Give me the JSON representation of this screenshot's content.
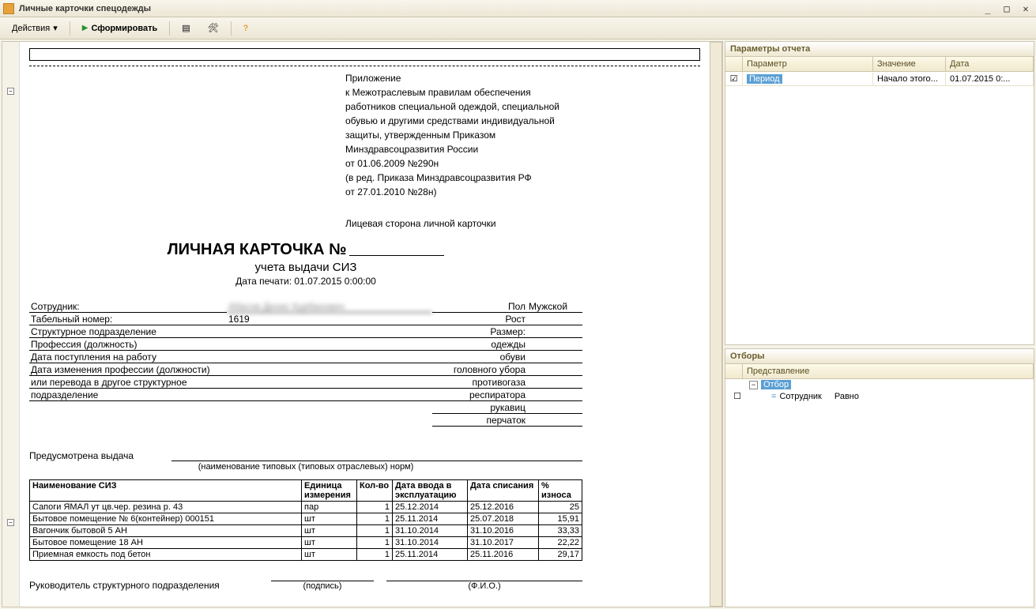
{
  "window": {
    "title": "Личные карточки спецодежды"
  },
  "toolbar": {
    "actions": "Действия",
    "generate": "Сформировать"
  },
  "doc": {
    "appendix": [
      "Приложение",
      "к Межотраслевым правилам обеспечения",
      "работников специальной одеждой, специальной",
      "обувью и другими средствами индивидуальной",
      "защиты, утвержденным Приказом",
      "Минздравсоцразвития России",
      "от 01.06.2009 №290н",
      "(в ред. Приказа Минздравсоцразвития РФ",
      "от 27.01.2010 №28н)"
    ],
    "face_side": "Лицевая сторона личной карточки",
    "title": "ЛИЧНАЯ КАРТОЧКА №",
    "subtitle": "учета выдачи СИЗ",
    "print_date": "Дата печати: 01.07.2015 0:00:00",
    "labels": {
      "employee": "Сотрудник:",
      "tab_no": "Табельный номер:",
      "struct": "Структурное подразделение",
      "job": "Профессия (должность)",
      "hire": "Дата поступления на работу",
      "change1": "Дата изменения профессии (должности)",
      "change2": "или перевода в другое структурное",
      "change3": "подразделение",
      "sex": "Пол",
      "height": "Рост",
      "size": "Размер:",
      "clothes": "одежды",
      "shoes": "обуви",
      "headgear": "головного убора",
      "gasmask": "противогаза",
      "respirator": "респиратора",
      "mittens": "рукавиц",
      "gloves": "перчаток"
    },
    "values": {
      "employee": "Абасов Денис Курбанович",
      "tab_no": "1619",
      "sex": "Мужской"
    },
    "predus": "Предусмотрена выдача",
    "predus_note": "(наименование типовых (типовых отраслевых) норм)",
    "table_headers": [
      "Наименование СИЗ",
      "Единица измерения",
      "Кол-во",
      "Дата ввода в эксплуатацию",
      "Дата списания",
      "% износа"
    ],
    "table_rows": [
      [
        "Сапоги ЯМАЛ ут цв.чер. резина р. 43",
        "пар",
        "1",
        "25.12.2014",
        "25.12.2016",
        "25"
      ],
      [
        "Бытовое помещение № 6(контейнер) 000151",
        "шт",
        "1",
        "25.11.2014",
        "25.07.2018",
        "15,91"
      ],
      [
        "Вагончик бытовой 5 АН",
        "шт",
        "1",
        "31.10.2014",
        "31.10.2016",
        "33,33"
      ],
      [
        "Бытовое помещение  18 АН",
        "шт",
        "1",
        "31.10.2014",
        "31.10.2017",
        "22,22"
      ],
      [
        "Приемная емкость под бетон",
        "шт",
        "1",
        "25.11.2014",
        "25.11.2016",
        "29,17"
      ]
    ],
    "head_struct": "Руководитель структурного подразделения",
    "sig_sign": "(подпись)",
    "sig_fio": "(Ф.И.О.)"
  },
  "params": {
    "title": "Параметры отчета",
    "cols": {
      "param": "Параметр",
      "value": "Значение",
      "date": "Дата"
    },
    "row": {
      "param": "Период",
      "value": "Начало этого...",
      "date": "01.07.2015 0:..."
    }
  },
  "filters": {
    "title": "Отборы",
    "col": "Представление",
    "root": "Отбор",
    "item": "Сотрудник",
    "cond": "Равно"
  }
}
